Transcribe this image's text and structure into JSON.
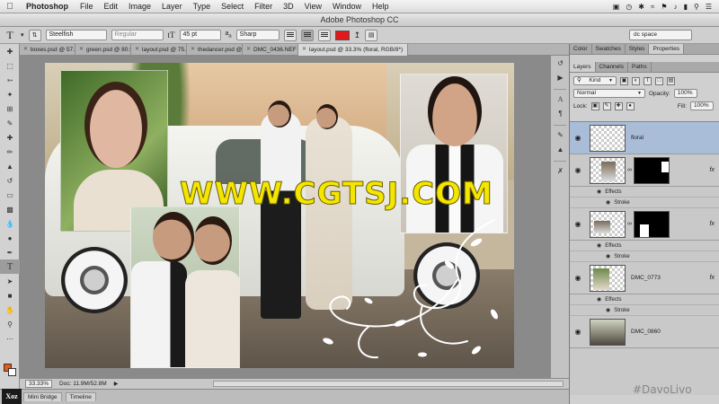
{
  "menubar": {
    "app": "Photoshop",
    "items": [
      "File",
      "Edit",
      "Image",
      "Layer",
      "Type",
      "Select",
      "Filter",
      "3D",
      "View",
      "Window",
      "Help"
    ]
  },
  "window_title": "Adobe Photoshop CC",
  "options_bar": {
    "font_family": "Steelfish",
    "font_style": "Regular",
    "font_size": "45 pt",
    "antialias": "Sharp",
    "text_color": "#e01a1a"
  },
  "workspace": "dc space",
  "doc_tabs": [
    {
      "label": "boxes.psd @ 57.5..."
    },
    {
      "label": "green.psd @ 80.9%..."
    },
    {
      "label": "layout.psd @ 75.8..."
    },
    {
      "label": "thedancer.psd @..."
    },
    {
      "label": "DMC_0436.NEF @..."
    },
    {
      "label": "layout.psd @ 33.3% (floral, RGB/8*)",
      "active": true
    }
  ],
  "canvas": {
    "watermark": "WWW.CGTSJ.COM"
  },
  "status": {
    "zoom": "33.33%",
    "doc_size": "Doc: 11.9M/52.8M"
  },
  "bottom_tabs": [
    "Mini Bridge",
    "Timeline"
  ],
  "logo": "Xoz",
  "panels": {
    "top_tabs": [
      "Color",
      "Swatches",
      "Styles",
      "Properties"
    ],
    "layer_tabs": [
      "Layers",
      "Channels",
      "Paths"
    ],
    "filter_kind": "Kind",
    "blend_mode": "Normal",
    "opacity_label": "Opacity:",
    "opacity_value": "100%",
    "lock_label": "Lock:",
    "fill_label": "Fill:",
    "fill_value": "100%"
  },
  "layers": [
    {
      "name": "floral",
      "selected": true
    },
    {
      "name": "",
      "effects": "Effects",
      "stroke": "Stroke",
      "fx": "fx"
    },
    {
      "name": "",
      "effects": "Effects",
      "stroke": "Stroke",
      "fx": "fx"
    },
    {
      "name": "DMC_0773",
      "effects": "Effects",
      "stroke": "Stroke",
      "fx": "fx"
    },
    {
      "name": "DMC_0860"
    }
  ],
  "footer_watermark": "#DavoLivo"
}
